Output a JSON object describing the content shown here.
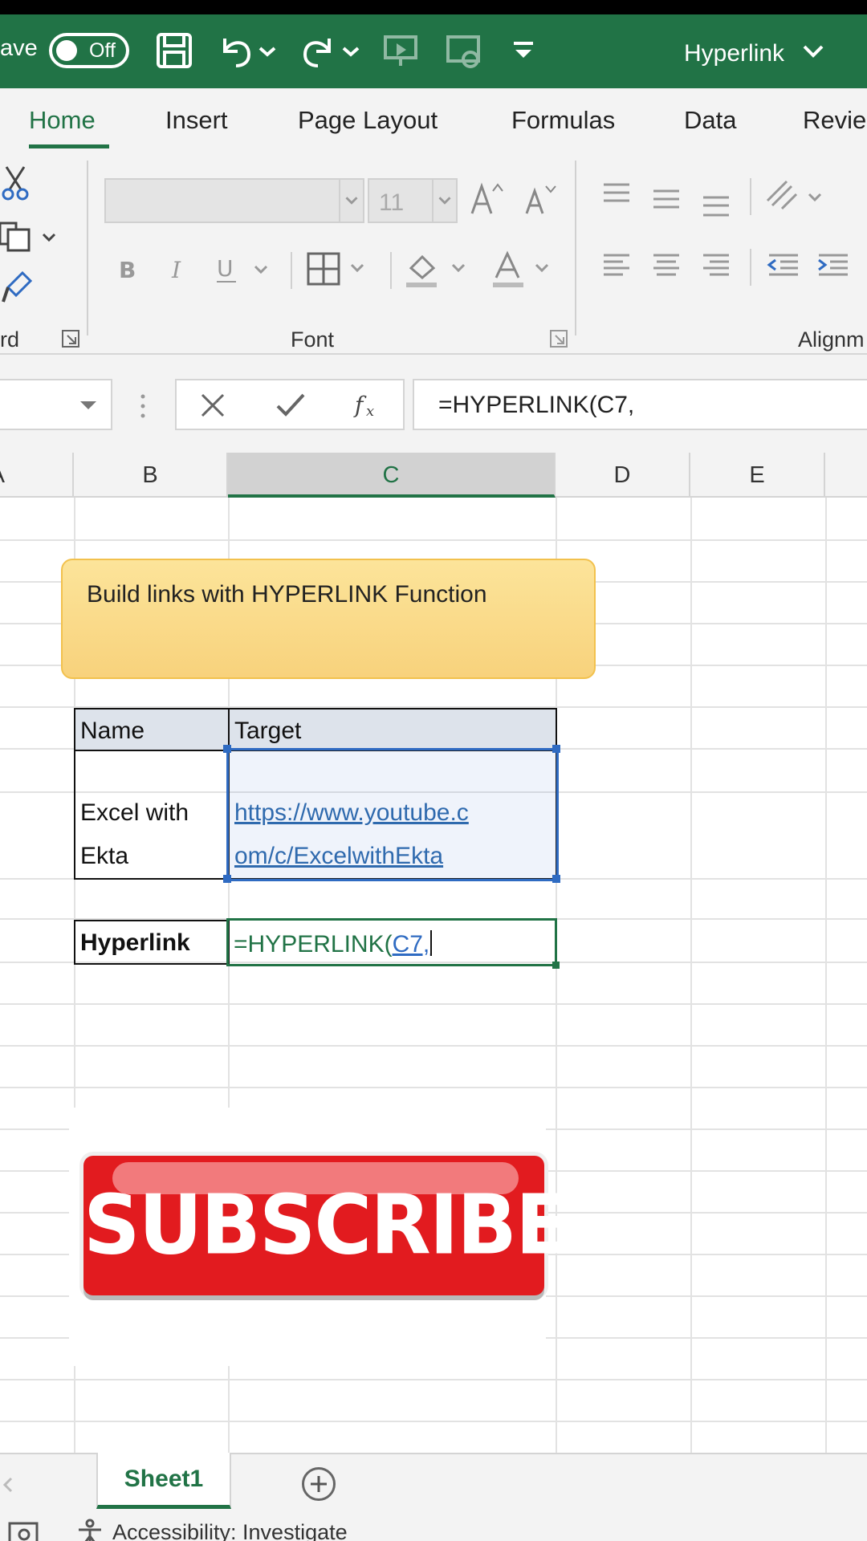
{
  "titlebar": {
    "autosave_label": "ave",
    "autosave_state": "Off",
    "workbook_title": "Hyperlink",
    "accent_color": "#217346"
  },
  "ribbon": {
    "tabs": [
      {
        "label": "Home"
      },
      {
        "label": "Insert"
      },
      {
        "label": "Page Layout"
      },
      {
        "label": "Formulas"
      },
      {
        "label": "Data"
      },
      {
        "label": "Revie"
      }
    ],
    "font_size": "11",
    "groups": {
      "clipboard": "rd",
      "font": "Font",
      "alignment": "Alignm"
    },
    "icons": [
      "cut-icon",
      "copy-icon",
      "format-painter-icon",
      "bold-icon",
      "italic-icon",
      "underline-icon",
      "borders-icon",
      "fill-color-icon",
      "font-color-icon",
      "increase-font-icon",
      "decrease-font-icon",
      "align-top-icon",
      "align-middle-icon",
      "align-bottom-icon",
      "orientation-icon",
      "align-left-icon",
      "align-center-icon",
      "align-right-icon",
      "decrease-indent-icon",
      "increase-indent-icon"
    ]
  },
  "formula_bar": {
    "cancel_symbol": "✕",
    "enter_symbol": "✓",
    "fx_label": "fx",
    "formula": "=HYPERLINK(C7,"
  },
  "columns": [
    "A",
    "B",
    "C",
    "D",
    "E"
  ],
  "sheet": {
    "callout_text": "Build links with HYPERLINK Function",
    "table": {
      "headers": [
        "Name",
        "Target"
      ],
      "row": {
        "name_line1": "Excel with",
        "name_line2": "Ekta",
        "url_line1": "https://www.youtube.c",
        "url_line2": "om/c/ExcelwithEkta"
      }
    },
    "hyperlink_label": "Hyperlink",
    "formula_prefix": "=HYPERLINK(",
    "formula_ref": "C7,"
  },
  "overlay": {
    "subscribe_text": "SUBSCRIBE",
    "button_color": "#e21b1f"
  },
  "sheet_tabs": {
    "active": "Sheet1"
  },
  "status": {
    "accessibility": "Accessibility: Investigate"
  }
}
